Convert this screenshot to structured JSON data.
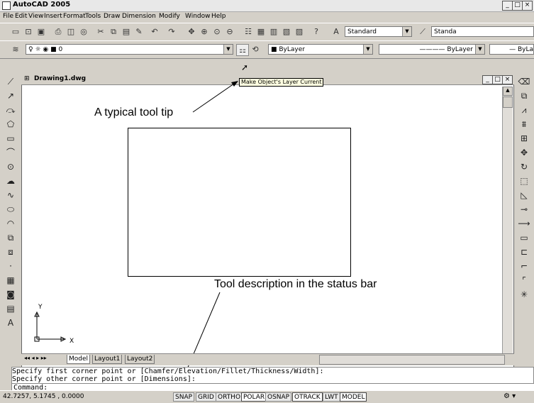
{
  "window": {
    "title": "AutoCAD 2005",
    "minimize": "_",
    "maximize": "□",
    "close": "×"
  },
  "menu": [
    "File",
    "Edit",
    "View",
    "Insert",
    "Format",
    "Tools",
    "Draw",
    "Dimension",
    "Modify",
    "Window",
    "Help"
  ],
  "styles_toolbar": {
    "text_style": "Standard",
    "dim_style": "Standa"
  },
  "layers_toolbar": {
    "layer": "0",
    "color": "ByLayer",
    "linetype": "ByLayer",
    "lineweight": "ByLa"
  },
  "drawing": {
    "title": "Drawing1.dwg"
  },
  "tooltip": "Make Object's Layer Current",
  "captions": {
    "tooltip_caption": "A typical tool tip",
    "status_caption": "Tool description in the status bar"
  },
  "ucs": {
    "y": "Y",
    "x": "X"
  },
  "tabs": [
    "Model",
    "Layout1",
    "Layout2"
  ],
  "command_lines": [
    "Specify first corner point or [Chamfer/Elevation/Fillet/Thickness/Width]:",
    "Specify other corner point or [Dimensions]:",
    "Command:"
  ],
  "status": {
    "coords": "42.7257, 5.1745 , 0.0000",
    "buttons": [
      "SNAP",
      "GRID",
      "ORTHO",
      "POLAR",
      "OSNAP",
      "OTRACK",
      "LWT",
      "MODEL"
    ]
  }
}
